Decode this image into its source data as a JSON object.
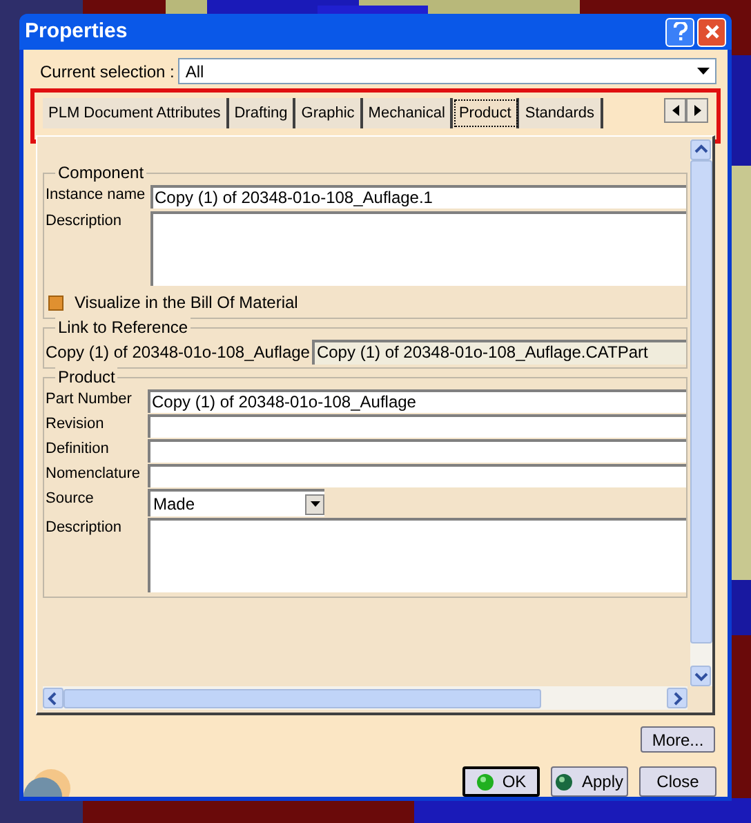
{
  "window": {
    "title": "Properties"
  },
  "current_selection": {
    "label": "Current selection :",
    "value": "All"
  },
  "tabs": [
    {
      "label": "PLM Document Attributes",
      "selected": false
    },
    {
      "label": "Drafting",
      "selected": false
    },
    {
      "label": "Graphic",
      "selected": false
    },
    {
      "label": "Mechanical",
      "selected": false
    },
    {
      "label": "Product",
      "selected": true
    },
    {
      "label": "Standards",
      "selected": false
    }
  ],
  "component": {
    "title": "Component",
    "fields": [
      {
        "label": "Instance name",
        "value": "Copy (1) of 20348-01o-108_Auflage.1",
        "kind": "text"
      },
      {
        "label": "Description",
        "kind": "multiline"
      }
    ],
    "visualize": {
      "label": "Visualize in the Bill Of Material",
      "checked": true
    }
  },
  "link": {
    "title": "Link to Reference",
    "label": "Copy (1) of 20348-01o-108_Auflage",
    "value": "Copy (1) of 20348-01o-108_Auflage.CATPart"
  },
  "product": {
    "title": "Product",
    "fields": [
      {
        "label": "Part Number",
        "value": "Copy (1) of 20348-01o-108_Auflage",
        "kind": "text"
      },
      {
        "label": "Revision",
        "kind": "text"
      },
      {
        "label": "Definition",
        "kind": "text"
      },
      {
        "label": "Nomenclature",
        "kind": "text"
      },
      {
        "label": "Source",
        "value": "Made",
        "kind": "dropdown"
      },
      {
        "label": "Description",
        "kind": "multiline"
      }
    ]
  },
  "more_button": {
    "label": "More..."
  },
  "buttons": [
    {
      "label": "OK",
      "kind": "ok"
    },
    {
      "label": "Apply",
      "kind": "apply"
    },
    {
      "label": "Close",
      "kind": "plain"
    }
  ]
}
